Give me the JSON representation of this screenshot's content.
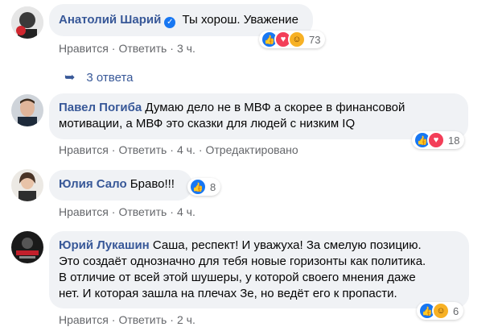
{
  "comments": [
    {
      "author": "Анатолий Шарий",
      "verified": true,
      "text": "Ты хорош. Уважение",
      "actions": {
        "like": "Нравится",
        "reply": "Ответить",
        "time": "3 ч."
      },
      "reactions_count": "73",
      "replies_label": "3 ответа"
    },
    {
      "author": "Павел Погиба",
      "text_line1": "Думаю дело не в МВФ а скорее в финансовой",
      "text_line2": "мотивации, а МВФ это сказки для людей с низким IQ",
      "actions": {
        "like": "Нравится",
        "reply": "Ответить",
        "time": "4 ч.",
        "edited": "Отредактировано"
      },
      "reactions_count": "18"
    },
    {
      "author": "Юлия Сало",
      "text": "Браво!!!",
      "actions": {
        "like": "Нравится",
        "reply": "Ответить",
        "time": "4 ч."
      },
      "reactions_count": "8"
    },
    {
      "author": "Юрий Лукашин",
      "text_line1": "Саша, респект! И уважуха! За смелую позицию.",
      "text_line2": "Это создаёт однозначно для тебя новые горизонты как политика.",
      "text_line3": "В отличие от всей этой шушеры, у которой своего мнения даже",
      "text_line4": "нет. И которая зашла на плечах Зе, но ведёт его к пропасти.",
      "actions": {
        "like": "Нравится",
        "reply": "Ответить",
        "time": "2 ч."
      },
      "reactions_count": "6"
    }
  ],
  "colors": {
    "link": "#385898",
    "bubble": "#f0f2f5",
    "meta": "#65676b",
    "like": "#1877f2"
  },
  "icons": [
    "reply-arrow-icon",
    "like-reaction-icon",
    "love-reaction-icon",
    "haha-reaction-icon",
    "verified-badge-icon"
  ]
}
